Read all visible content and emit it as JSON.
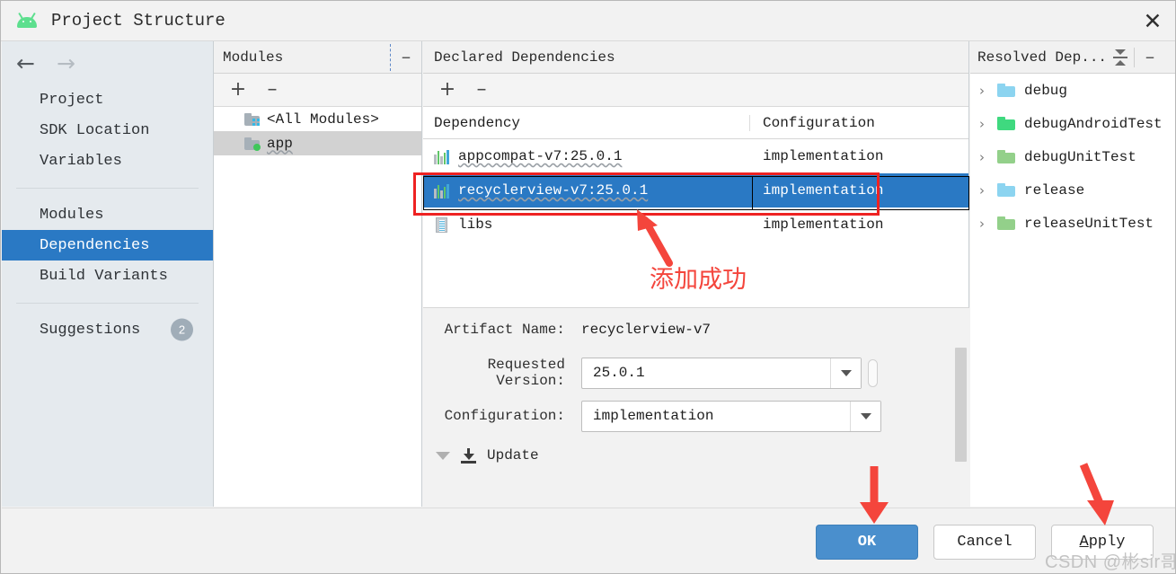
{
  "window": {
    "title": "Project Structure",
    "app_icon": "android-icon",
    "close_label": "✕"
  },
  "sidebar": {
    "back_icon": "arrow-left-icon",
    "forward_icon": "arrow-right-icon",
    "groups": [
      {
        "items": [
          {
            "label": "Project",
            "selected": false
          },
          {
            "label": "SDK Location",
            "selected": false
          },
          {
            "label": "Variables",
            "selected": false
          }
        ]
      },
      {
        "items": [
          {
            "label": "Modules",
            "selected": false
          },
          {
            "label": "Dependencies",
            "selected": true
          },
          {
            "label": "Build Variants",
            "selected": false
          }
        ]
      },
      {
        "items": [
          {
            "label": "Suggestions",
            "selected": false,
            "badge": "2"
          }
        ]
      }
    ]
  },
  "modules_panel": {
    "title": "Modules",
    "toolbar": {
      "add_label": "+",
      "remove_label": "–"
    },
    "rows": [
      {
        "label": "<All Modules>",
        "icon": "folder-modules-icon",
        "selected": false
      },
      {
        "label": "app",
        "icon": "folder-app-icon",
        "selected": true
      }
    ],
    "minimize_label": "–"
  },
  "dependencies_panel": {
    "title": "Declared Dependencies",
    "toolbar": {
      "add_label": "+",
      "remove_label": "–"
    },
    "columns": [
      "Dependency",
      "Configuration"
    ],
    "rows": [
      {
        "dependency": "appcompat-v7:25.0.1",
        "configuration": "implementation",
        "icon": "library-icon",
        "selected": false
      },
      {
        "dependency": "recyclerview-v7:25.0.1",
        "configuration": "implementation",
        "icon": "library-icon",
        "selected": true
      },
      {
        "dependency": "libs",
        "configuration": "implementation",
        "icon": "jar-icon",
        "selected": false
      }
    ]
  },
  "detail": {
    "artifact_name_label": "Artifact Name:",
    "artifact_name_value": "recyclerview-v7",
    "requested_version_label": "Requested Version:",
    "requested_version_value": "25.0.1",
    "configuration_label": "Configuration:",
    "configuration_value": "implementation",
    "update_label": "Update"
  },
  "resolved_panel": {
    "title": "Resolved Dep...",
    "collapse_icon": "collapse-all-icon",
    "minimize_label": "–",
    "rows": [
      {
        "label": "debug",
        "chevron": "›",
        "color": "#8cd4f0"
      },
      {
        "label": "debugAndroidTest",
        "chevron": "›",
        "color": "#3fd97f"
      },
      {
        "label": "debugUnitTest",
        "chevron": "›",
        "color": "#93d08a"
      },
      {
        "label": "release",
        "chevron": "›",
        "color": "#8cd4f0"
      },
      {
        "label": "releaseUnitTest",
        "chevron": "›",
        "color": "#93d08a"
      }
    ]
  },
  "footer": {
    "ok_label": "OK",
    "cancel_label": "Cancel",
    "apply_mnemonic": "A",
    "apply_rest": "pply",
    "watermark": "CSDN @彬sir哥"
  },
  "annotations": {
    "note_text": "添加成功",
    "accent_color": "#ee2222"
  }
}
